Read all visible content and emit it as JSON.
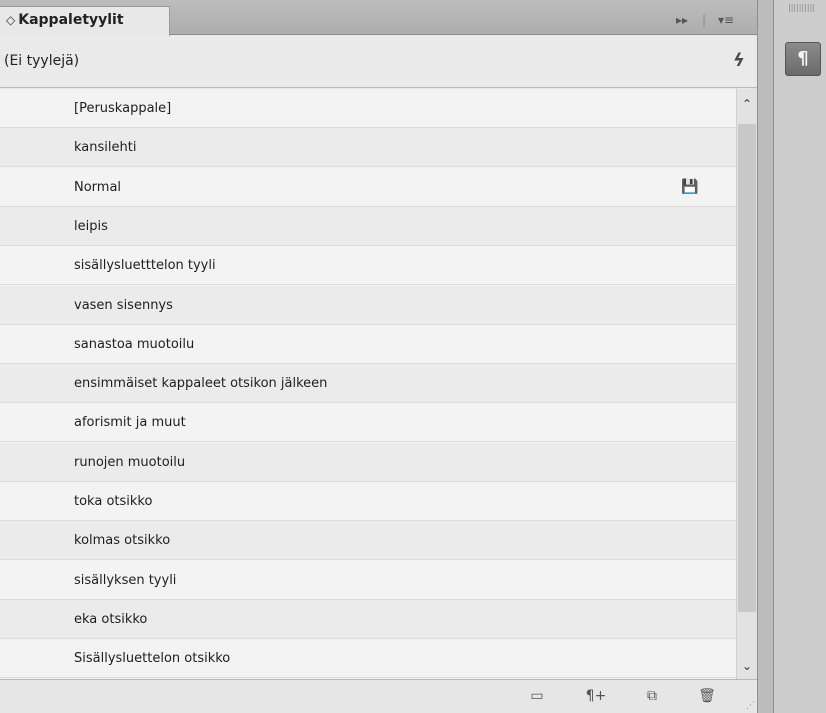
{
  "panel": {
    "tab_title": "Kappaletyylit",
    "tab_arrows": "◇",
    "collapse_icon": "▸▸",
    "menu_icon": "▾≡"
  },
  "filter": {
    "text": "(Ei tyylejä)",
    "bolt_icon": "ϟ"
  },
  "styles": [
    {
      "label": "[Peruskappale]",
      "saved": false
    },
    {
      "label": "kansilehti",
      "saved": false
    },
    {
      "label": "Normal",
      "saved": true
    },
    {
      "label": "leipis",
      "saved": false
    },
    {
      "label": "sisällysluetttelon tyyli",
      "saved": false
    },
    {
      "label": "vasen sisennys",
      "saved": false
    },
    {
      "label": "sanastoa muotoilu",
      "saved": false
    },
    {
      "label": "ensimmäiset kappaleet otsikon jälkeen",
      "saved": false
    },
    {
      "label": "aforismit ja muut",
      "saved": false
    },
    {
      "label": "runojen muotoilu",
      "saved": false
    },
    {
      "label": "toka otsikko",
      "saved": false
    },
    {
      "label": "kolmas otsikko",
      "saved": false
    },
    {
      "label": "sisällyksen tyyli",
      "saved": false
    },
    {
      "label": "eka otsikko",
      "saved": false
    },
    {
      "label": "Sisällysluettelon otsikko",
      "saved": false
    }
  ],
  "icons": {
    "save": "💾",
    "scroll_up": "⌃",
    "scroll_down": "⌄",
    "folder": "▭",
    "clear_overrides": "¶+",
    "new_style": "⧉",
    "delete": "🗑",
    "grip": "⋰",
    "sidebar_dots": "||||||||||",
    "sidebar_paragraph": "¶"
  }
}
